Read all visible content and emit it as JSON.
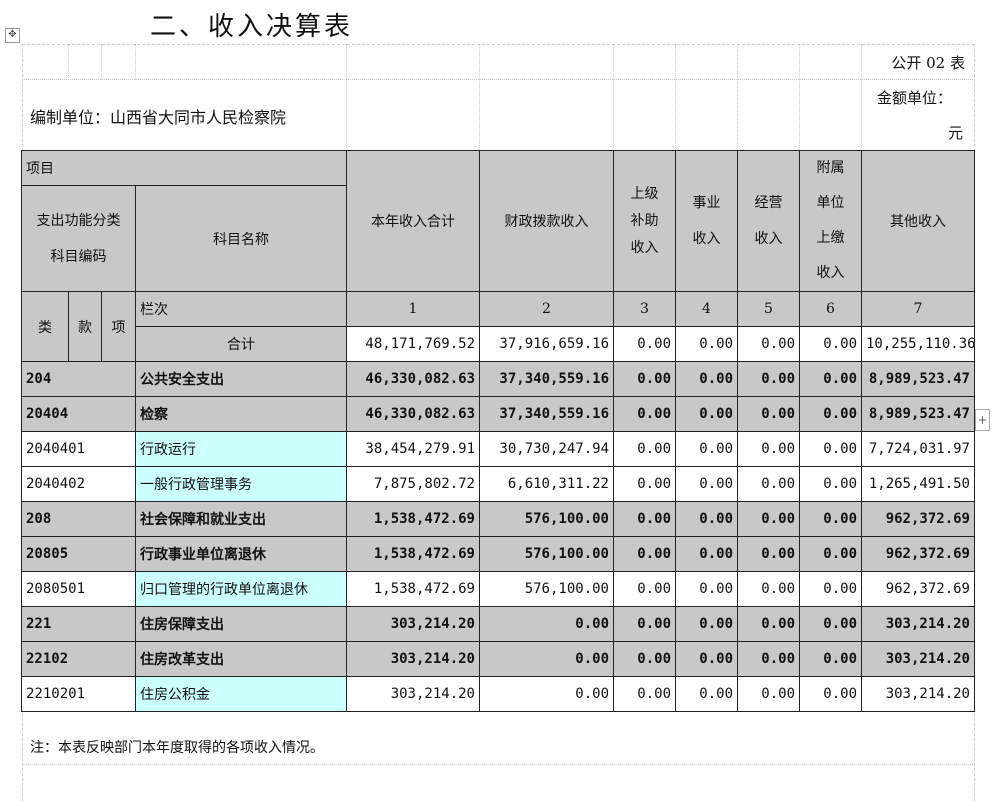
{
  "title": "二、收入决算表",
  "form_no": "公开 02 表",
  "unit_label": "编制单位：山西省大同市人民检察院",
  "money_unit_label": "金额单位：",
  "money_unit_value": "元",
  "header": {
    "item": "项目",
    "func_code": "支出功能分类科目编码",
    "subject_name": "科目名称",
    "total_income": "本年收入合计",
    "fiscal": "财政拨款收入",
    "superior": "上级补助收入",
    "business": "事业收入",
    "operating": "经营收入",
    "subsidiary": "附属单位上缴收入",
    "other": "其他收入",
    "lei": "类",
    "kuan": "款",
    "xiang": "项",
    "lanci": "栏次",
    "col_nums": [
      "1",
      "2",
      "3",
      "4",
      "5",
      "6",
      "7"
    ],
    "total_label": "合计"
  },
  "total_row": [
    "48,171,769.52",
    "37,916,659.16",
    "0.00",
    "0.00",
    "0.00",
    "0.00",
    "10,255,110.36"
  ],
  "rows": [
    {
      "code": "204",
      "name": "公共安全支出",
      "level": "grey",
      "values": [
        "46,330,082.63",
        "37,340,559.16",
        "0.00",
        "0.00",
        "0.00",
        "0.00",
        "8,989,523.47"
      ]
    },
    {
      "code": "20404",
      "name": "检察",
      "level": "grey",
      "values": [
        "46,330,082.63",
        "37,340,559.16",
        "0.00",
        "0.00",
        "0.00",
        "0.00",
        "8,989,523.47"
      ]
    },
    {
      "code": "2040401",
      "name": "行政运行",
      "level": "white",
      "values": [
        "38,454,279.91",
        "30,730,247.94",
        "0.00",
        "0.00",
        "0.00",
        "0.00",
        "7,724,031.97"
      ]
    },
    {
      "code": "2040402",
      "name": "一般行政管理事务",
      "level": "white",
      "values": [
        "7,875,802.72",
        "6,610,311.22",
        "0.00",
        "0.00",
        "0.00",
        "0.00",
        "1,265,491.50"
      ]
    },
    {
      "code": "208",
      "name": "社会保障和就业支出",
      "level": "grey",
      "values": [
        "1,538,472.69",
        "576,100.00",
        "0.00",
        "0.00",
        "0.00",
        "0.00",
        "962,372.69"
      ]
    },
    {
      "code": "20805",
      "name": "行政事业单位离退休",
      "level": "grey",
      "values": [
        "1,538,472.69",
        "576,100.00",
        "0.00",
        "0.00",
        "0.00",
        "0.00",
        "962,372.69"
      ]
    },
    {
      "code": "2080501",
      "name": "归口管理的行政单位离退休",
      "level": "white",
      "values": [
        "1,538,472.69",
        "576,100.00",
        "0.00",
        "0.00",
        "0.00",
        "0.00",
        "962,372.69"
      ]
    },
    {
      "code": "221",
      "name": "住房保障支出",
      "level": "grey",
      "values": [
        "303,214.20",
        "0.00",
        "0.00",
        "0.00",
        "0.00",
        "0.00",
        "303,214.20"
      ]
    },
    {
      "code": "22102",
      "name": "住房改革支出",
      "level": "grey",
      "values": [
        "303,214.20",
        "0.00",
        "0.00",
        "0.00",
        "0.00",
        "0.00",
        "303,214.20"
      ]
    },
    {
      "code": "2210201",
      "name": "住房公积金",
      "level": "white",
      "values": [
        "303,214.20",
        "0.00",
        "0.00",
        "0.00",
        "0.00",
        "0.00",
        "303,214.20"
      ]
    }
  ],
  "note": "注：本表反映部门本年度取得的各项收入情况。",
  "icons": {
    "move": "move-handle-icon",
    "add": "add-column-icon"
  }
}
